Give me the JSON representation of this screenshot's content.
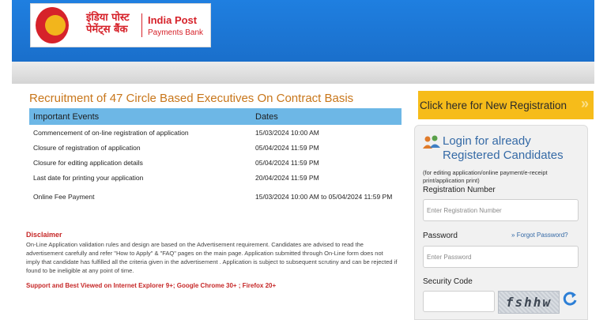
{
  "header": {
    "logo_hindi": "इंडिया पोस्ट पेमेंट्स बैंक",
    "logo_en_line1": "India Post",
    "logo_en_line2": "Payments Bank"
  },
  "main": {
    "title": "Recruitment of 47 Circle Based Executives On Contract Basis",
    "table": {
      "headers": [
        "Important Events",
        "Dates"
      ],
      "rows": [
        [
          "Commencement of on-line registration of application",
          "15/03/2024 10:00 AM"
        ],
        [
          "Closure of registration of application",
          "05/04/2024 11:59 PM"
        ],
        [
          "Closure for editing application details",
          "05/04/2024 11:59 PM"
        ],
        [
          "Last date for printing your application",
          "20/04/2024 11:59 PM"
        ],
        [
          "Online Fee Payment",
          "15/03/2024 10:00 AM to 05/04/2024 11:59 PM"
        ]
      ]
    },
    "disclaimer_title": "Disclaimer",
    "disclaimer_text": "On-Line Application validation rules and design are based on the Advertisement requirement. Candidates are advised to read the advertisement carefully and refer \"How to Apply\" & \"FAQ\" pages on the main page. Application submitted through On-Line form does not imply that candidate has fulfilled all the criteria given in the advertisement . Application is subject to subsequent scrutiny and can be rejected if found to be ineligible at any point of time.",
    "support_note": "Support and Best Viewed on Internet Explorer 9+; Google Chrome 30+ ; Firefox 20+"
  },
  "sidebar": {
    "new_registration": "Click here for New Registration",
    "login_title": "Login for already Registered Candidates",
    "login_subtitle": "(for editing application/online payment/e-receipt print/application print)",
    "registration_label": "Registration Number",
    "registration_placeholder": "Enter Registration Number",
    "password_label": "Password",
    "forgot_password": "Forgot Password?",
    "password_placeholder": "Enter Password",
    "security_code_label": "Security Code",
    "security_code_value": "",
    "captcha_text": "fshhw"
  },
  "colors": {
    "header_blue": "#1e7ad9",
    "accent_orange": "#c8761a",
    "table_header": "#6db7e6",
    "button_yellow": "#f6bc1a",
    "disclaimer_red": "#c62828",
    "link_blue": "#356aa6"
  }
}
